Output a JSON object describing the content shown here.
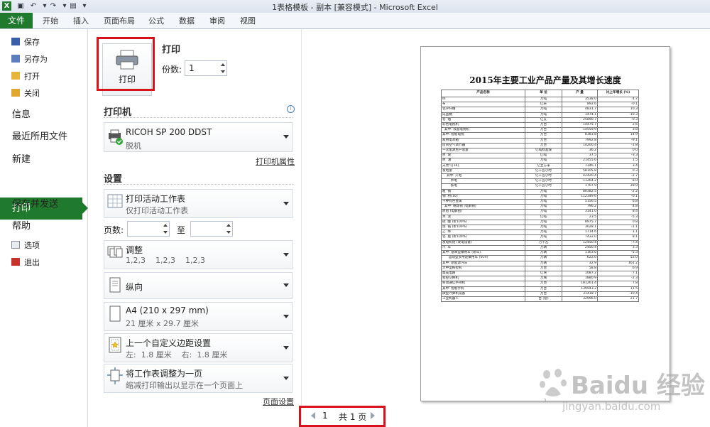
{
  "window": {
    "title": "1表格模板 - 副本  [兼容模式]  -  Microsoft Excel"
  },
  "ribbon": {
    "tabs": [
      "文件",
      "开始",
      "插入",
      "页面布局",
      "公式",
      "数据",
      "审阅",
      "视图"
    ]
  },
  "nav": {
    "small_top": [
      "保存",
      "另存为",
      "打开",
      "关闭"
    ],
    "large": [
      "信息",
      "最近所用文件",
      "新建",
      "打印",
      "保存并发送",
      "帮助"
    ],
    "small_bottom": [
      "选项",
      "退出"
    ]
  },
  "print": {
    "button_label": "打印",
    "section_title": "打印",
    "copies_label": "份数:",
    "copies_value": "1",
    "printer_title": "打印机",
    "printer_name": "RICOH SP 200 DDST",
    "printer_status": "脱机",
    "printer_props": "打印机属性",
    "settings_title": "设置",
    "what": {
      "title": "打印活动工作表",
      "sub": "仅打印活动工作表"
    },
    "pages_label": "页数:",
    "pages_to": "至",
    "collate": {
      "title": "调整",
      "sub": "1,2,3    1,2,3    1,2,3"
    },
    "orientation": {
      "title": "纵向"
    },
    "paper": {
      "title": "A4 (210 x 297 mm)",
      "sub": "21 厘米 x 29.7 厘米"
    },
    "margins": {
      "title": "上一个自定义边距设置",
      "sub": "左:  1.8 厘米    右:  1.8 厘米"
    },
    "scaling": {
      "title": "将工作表调整为一页",
      "sub": "缩减打印输出以显示在一个页面上"
    },
    "page_setup": "页面设置"
  },
  "preview": {
    "title": "2015年主要工业产品产量及其增长速度",
    "headers": [
      "产品名称",
      "单  位",
      "产  量",
      "比上年增长 (%)"
    ],
    "rows": [
      [
        "纱",
        "万吨",
        "3538.0",
        "4.7"
      ],
      [
        "布",
        "亿米",
        "892.6",
        "-0.1"
      ],
      [
        "化学纤维",
        "万吨",
        "4831.7",
        "10.3"
      ],
      [
        "成品糖",
        "万吨",
        "1474.1",
        "-10.3"
      ],
      [
        "卷  烟",
        "亿支",
        "25890.7",
        "-0.3"
      ],
      [
        "彩色电视机",
        "万台",
        "14475.7",
        "2.6"
      ],
      [
        "  其中: 液晶电视机",
        "万台",
        "14559.9",
        "3.8"
      ],
      [
        "其中: 智能电视",
        "万台",
        "8383.8",
        "14.9"
      ],
      [
        "家用电冰箱",
        "万台",
        "7992.8",
        "-9.1"
      ],
      [
        "房间空气调节器",
        "万台",
        "14200.4",
        "-1.8"
      ],
      [
        "一次能源生产总量",
        "亿吨标准煤",
        "36.2",
        "0.0"
      ],
      [
        "原  煤",
        "亿吨",
        "37.5",
        "-3.3"
      ],
      [
        "原  油",
        "万吨",
        "21455.6",
        "1.5"
      ],
      [
        "天然气[16]",
        "亿立方米",
        "1346.1",
        "3.4"
      ],
      [
        "发电量",
        "亿千瓦小时",
        "58105.8",
        "0.3"
      ],
      [
        "    其中: 火电",
        "亿千瓦小时",
        "42420.4",
        "-2.7"
      ],
      [
        "        水电",
        "亿千瓦小时",
        "11264.2",
        "8.0"
      ],
      [
        "        核电",
        "亿千瓦小时",
        "1707.9",
        "28.9"
      ],
      [
        "粗  钢",
        "万吨",
        "80382.5",
        "-2.2"
      ],
      [
        "钢  材[16]",
        "万吨",
        "112349.6",
        "-0.1"
      ],
      [
        "十种有色金属",
        "万吨",
        "5156.5",
        "6.8"
      ],
      [
        "  其中: 精炼铜 (电解铜)",
        "万吨",
        "796.2",
        "4.8"
      ],
      [
        "原铝 (电解铝)",
        "万吨",
        "3141.0",
        "8.4"
      ],
      [
        "水  泥",
        "亿吨",
        "23.5",
        "-5.3"
      ],
      [
        "硫  酸 (折100%)",
        "万吨",
        "8975.7",
        "0.8"
      ],
      [
        "烧  碱 (折100%)",
        "万吨",
        "3028.1",
        "-1.1"
      ],
      [
        "乙  烯",
        "万吨",
        "1714.6",
        "1.1"
      ],
      [
        "化  肥 (折100%)",
        "万吨",
        "7432.0",
        "8.1"
      ],
      [
        "发电机组 (发电设备)",
        "万千瓦",
        "12450.4",
        "-7.4"
      ],
      [
        "汽  车",
        "万辆",
        "2450.4",
        "3.3"
      ],
      [
        "其中: 基本型乘用车 (轿车)",
        "万辆",
        "1163.0",
        "-5.3"
      ],
      [
        "      运动型多用途乘用车 (SUV)",
        "万辆",
        "622.0",
        "52.0"
      ],
      [
        "其中: 新能源汽车",
        "万辆",
        "32.9",
        "161.2"
      ],
      [
        "大中型拖拉机",
        "万台",
        "58.8",
        "6.9"
      ],
      [
        "集成电路",
        "亿块",
        "1087.2",
        "7.1"
      ],
      [
        "程控交换机",
        "万线",
        "1880.9",
        "-2.3"
      ],
      [
        "移动通信手持机",
        "万台",
        "181261.4",
        "7.8"
      ],
      [
        "其中: 智能手机",
        "万台",
        "139943.2",
        "11.5"
      ],
      [
        "微型计算机设备",
        "万台",
        "31418.7",
        "-10.4"
      ],
      [
        "工业机器人",
        "台 (套)",
        "32996.0",
        "21.7"
      ]
    ],
    "page_number": "1"
  },
  "pagenav": {
    "current": "1",
    "total_text": "共 1 页"
  },
  "watermark": {
    "logo": "Baidu 经验",
    "url": "jingyan.baidu.com"
  }
}
